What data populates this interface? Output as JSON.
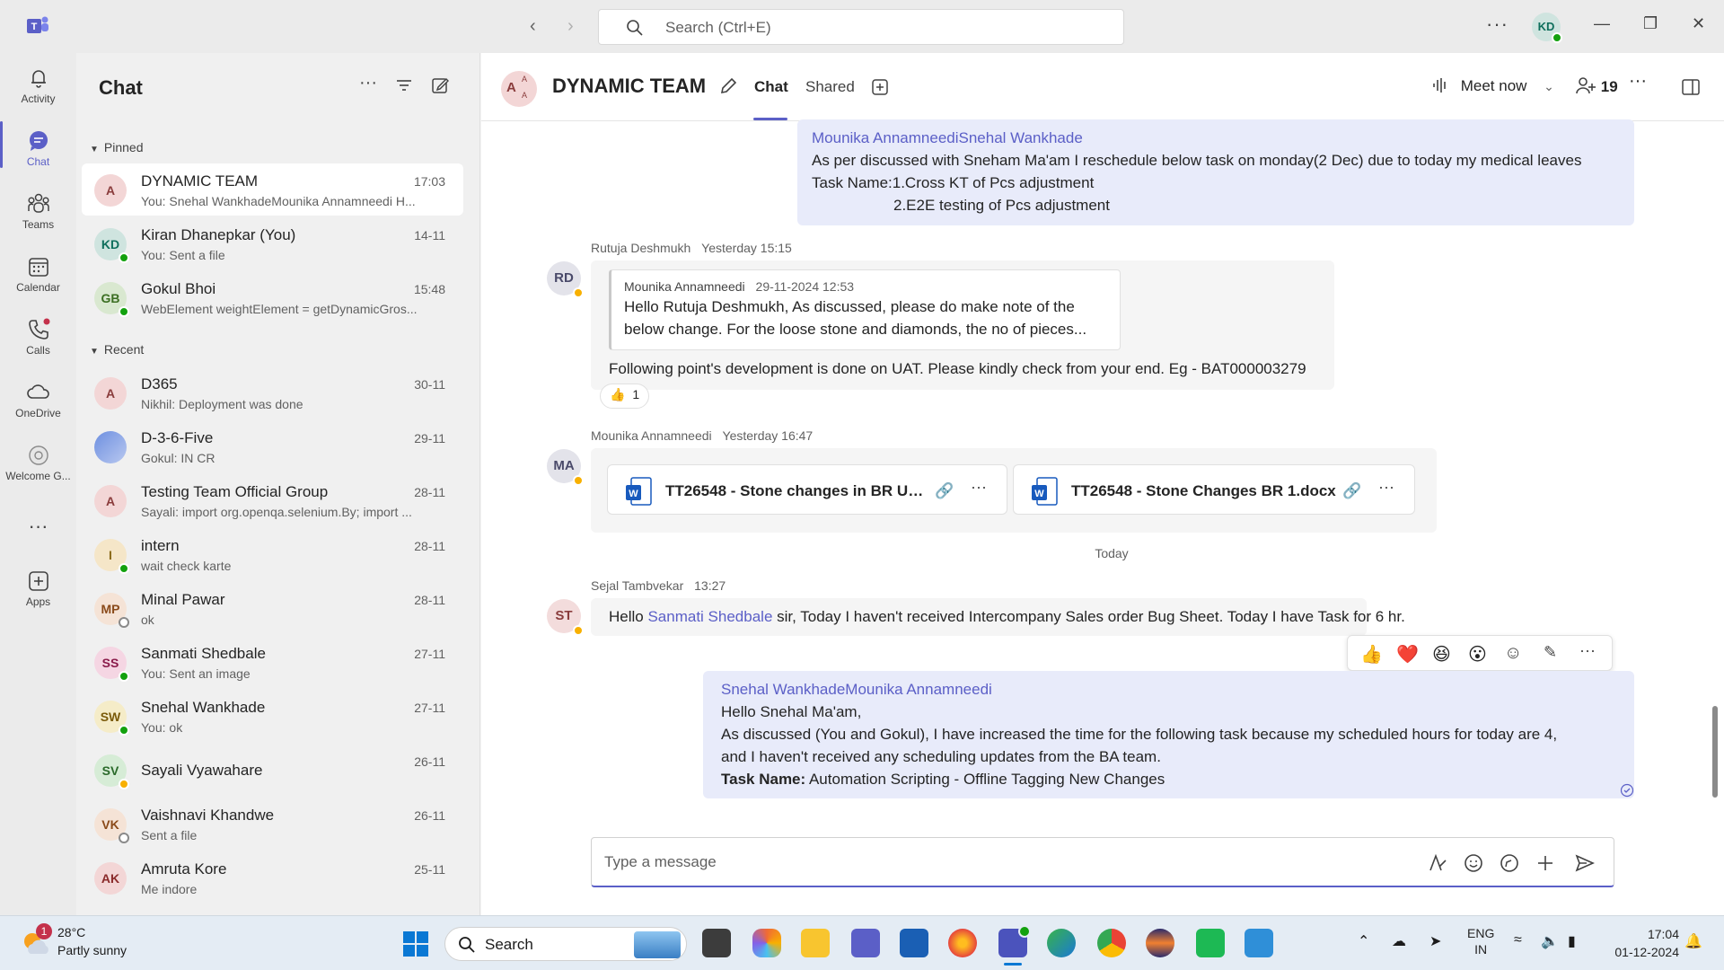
{
  "titlebar": {
    "search_placeholder": "Search (Ctrl+E)",
    "user_initials": "KD",
    "more_label": "···"
  },
  "rail": {
    "items": [
      {
        "label": "Activity",
        "icon": "bell-icon"
      },
      {
        "label": "Chat",
        "icon": "chat-icon"
      },
      {
        "label": "Teams",
        "icon": "teams-icon"
      },
      {
        "label": "Calendar",
        "icon": "calendar-icon"
      },
      {
        "label": "Calls",
        "icon": "phone-icon"
      },
      {
        "label": "OneDrive",
        "icon": "cloud-icon"
      },
      {
        "label": "Welcome G...",
        "icon": "globe-icon"
      },
      {
        "label": "Apps",
        "icon": "plus-box-icon"
      }
    ],
    "more": "···"
  },
  "chatlist": {
    "title": "Chat",
    "pinned_label": "Pinned",
    "recent_label": "Recent",
    "pinned": [
      {
        "name": "DYNAMIC TEAM",
        "preview": "You: Snehal WankhadeMounika Annamneedi H...",
        "time": "17:03",
        "initials": "A",
        "avatar_bg": "#f3d6d6",
        "avatar_fg": "#8a3c3c"
      },
      {
        "name": "Kiran Dhanepkar (You)",
        "preview": "You: Sent a file",
        "time": "14-11",
        "initials": "KD",
        "avatar_bg": "#cfe4df",
        "avatar_fg": "#0f6f5c"
      },
      {
        "name": "Gokul Bhoi",
        "preview": "WebElement weightElement = getDynamicGros...",
        "time": "15:48",
        "initials": "GB",
        "avatar_bg": "#d9e8d0",
        "avatar_fg": "#3b6e22"
      }
    ],
    "recent": [
      {
        "name": "D365",
        "preview": "Nikhil: Deployment was done",
        "time": "30-11",
        "initials": "A",
        "avatar_bg": "#f3d6d6",
        "avatar_fg": "#8a3c3c"
      },
      {
        "name": "D-3-6-Five",
        "preview": "Gokul: IN CR",
        "time": "29-11",
        "initials": "",
        "avatar_bg": "#9bb8e8",
        "avatar_fg": "#1f3d7a"
      },
      {
        "name": "Testing Team Official Group",
        "preview": "Sayali: import org.openqa.selenium.By; import ...",
        "time": "28-11",
        "initials": "A",
        "avatar_bg": "#f3d6d6",
        "avatar_fg": "#8a3c3c"
      },
      {
        "name": "intern",
        "preview": "wait check karte",
        "time": "28-11",
        "initials": "I",
        "avatar_bg": "#f5e6c8",
        "avatar_fg": "#8a6a1a"
      },
      {
        "name": "Minal Pawar",
        "preview": "ok",
        "time": "28-11",
        "initials": "MP",
        "avatar_bg": "#f5e3d6",
        "avatar_fg": "#8a4a1a"
      },
      {
        "name": "Sanmati Shedbale",
        "preview": "You: Sent an image",
        "time": "27-11",
        "initials": "SS",
        "avatar_bg": "#f5d6e3",
        "avatar_fg": "#8a1a4a"
      },
      {
        "name": "Snehal Wankhade",
        "preview": "You: ok",
        "time": "27-11",
        "initials": "SW",
        "avatar_bg": "#f5ecc8",
        "avatar_fg": "#7a5a0a"
      },
      {
        "name": "Sayali Vyawahare",
        "preview": "",
        "time": "26-11",
        "initials": "SV",
        "avatar_bg": "#d6ecd6",
        "avatar_fg": "#2a6a2a"
      },
      {
        "name": "Vaishnavi Khandwe",
        "preview": "Sent a file",
        "time": "26-11",
        "initials": "VK",
        "avatar_bg": "#f5e3d6",
        "avatar_fg": "#8a4a1a"
      },
      {
        "name": "Amruta Kore",
        "preview": "Me indore",
        "time": "25-11",
        "initials": "AK",
        "avatar_bg": "#f3d6d6",
        "avatar_fg": "#8a2a2a"
      }
    ]
  },
  "header": {
    "title": "DYNAMIC TEAM",
    "tab_chat": "Chat",
    "tab_shared": "Shared",
    "meet_now": "Meet now",
    "participants": "19"
  },
  "messages": {
    "msg1": {
      "mentions": "Mounika AnnamneediSnehal Wankhade",
      "line1": "As per discussed with Sneham Ma'am I reschedule below task on monday(2 Dec) due to today my medical leaves",
      "line2": "Task Name:1.Cross KT of Pcs adjustment",
      "line3": "2.E2E testing of Pcs adjustment"
    },
    "msg2": {
      "sender": "Rutuja Deshmukh",
      "time": "Yesterday 15:15",
      "initials": "RD",
      "quote_author": "Mounika Annamneedi",
      "quote_time": "29-11-2024 12:53",
      "quote_line1": "Hello Rutuja Deshmukh, As discussed, please do make note of the",
      "quote_line2": "below change. For the loose stone and diamonds, the no of pieces...",
      "text": "Following point's development is done on UAT. Please kindly check from your end. Eg - BAT000003279",
      "reaction_count": "1"
    },
    "msg3": {
      "sender": "Mounika Annamneedi",
      "time": "Yesterday 16:47",
      "initials": "MA",
      "file1": "TT26548 - Stone changes in BR Us...",
      "file2": "TT26548 - Stone Changes BR 1.docx"
    },
    "divider": "Today",
    "msg4": {
      "sender": "Sejal Tambvekar",
      "time": "13:27",
      "initials": "ST",
      "pre": "Hello ",
      "mention": "Sanmati Shedbale",
      "post": " sir, Today I haven't received Intercompany Sales order Bug Sheet. Today I have Task for 6 hr."
    },
    "msg5": {
      "mentions": "Snehal WankhadeMounika Annamneedi",
      "line1": "Hello Snehal Ma'am,",
      "line2": "As discussed (You and  Gokul), I have increased the time for the following task because my scheduled hours for today are 4,",
      "line3": "and I haven't received any scheduling updates from the BA team.",
      "task_label": "Task Name:",
      "task_value": " Automation Scripting - Offline Tagging New Changes"
    }
  },
  "composer": {
    "placeholder": "Type a message"
  },
  "taskbar": {
    "weather_badge": "1",
    "temp": "28°C",
    "condition": "Partly sunny",
    "search_label": "Search",
    "lang1": "ENG",
    "lang2": "IN",
    "time": "17:04",
    "date": "01-12-2024"
  },
  "colors": {
    "accent": "#5b5fc7",
    "my_bubble": "#e8ebfa",
    "presence_available": "#13a10e",
    "presence_away": "#f8b000"
  }
}
